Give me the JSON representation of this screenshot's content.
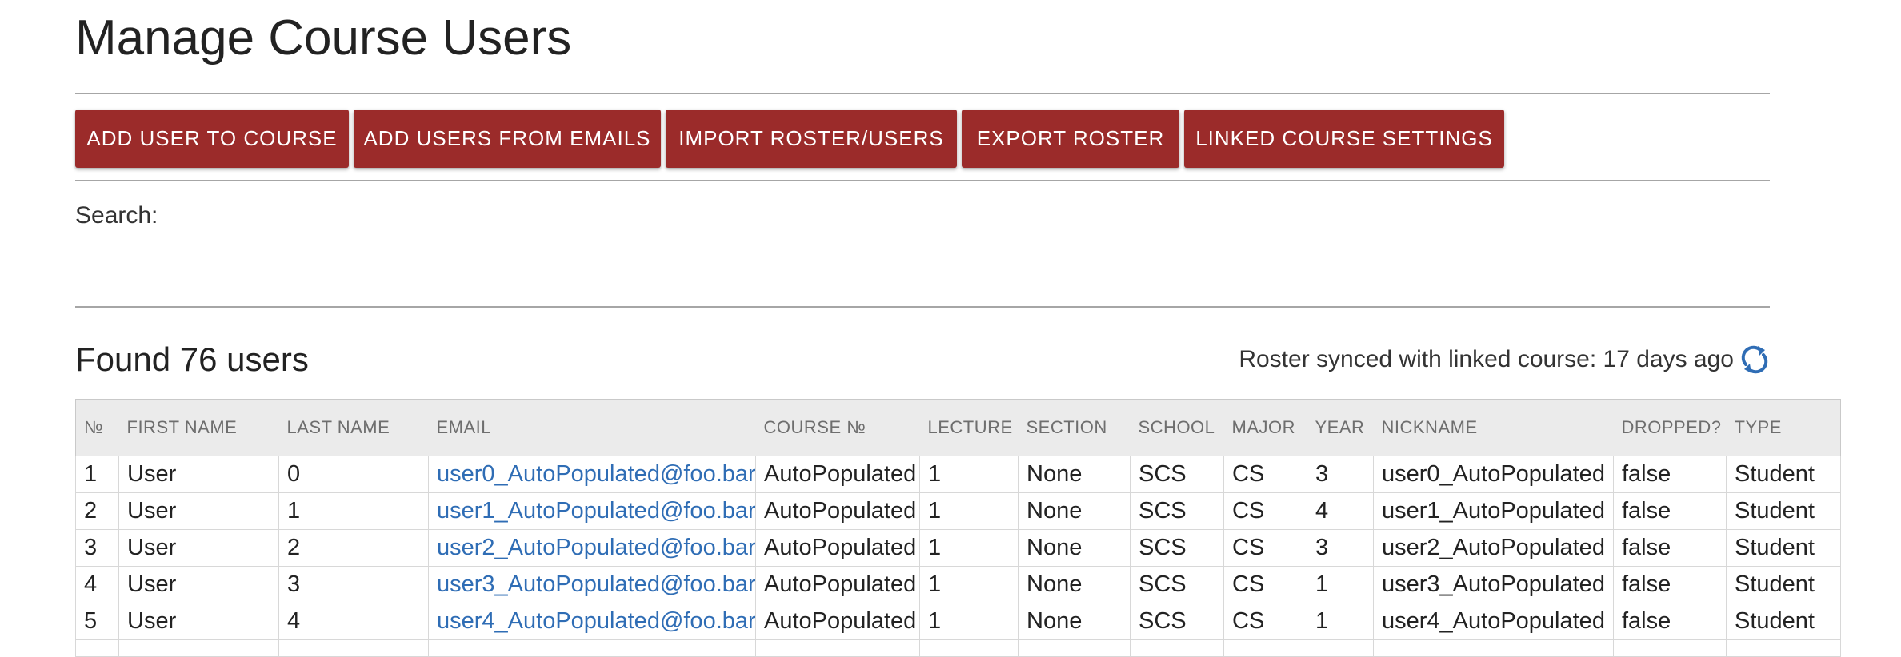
{
  "page_title": "Manage Course Users",
  "toolbar": {
    "buttons": [
      "ADD USER TO COURSE",
      "ADD USERS FROM EMAILS",
      "IMPORT ROSTER/USERS",
      "EXPORT ROSTER",
      "LINKED COURSE SETTINGS"
    ]
  },
  "search": {
    "label": "Search:",
    "value": ""
  },
  "results": {
    "heading": "Found 76 users",
    "sync_status": "Roster synced with linked course: 17 days ago",
    "sync_icon": "refresh-icon",
    "link_color": "#2f6db5"
  },
  "colors": {
    "button_bg": "#9b2b2a",
    "button_text": "#ffffff",
    "header_bg": "#ebebeb"
  },
  "table": {
    "columns": [
      "№",
      "FIRST NAME",
      "LAST NAME",
      "EMAIL",
      "COURSE №",
      "LECTURE",
      "SECTION",
      "SCHOOL",
      "MAJOR",
      "YEAR",
      "NICKNAME",
      "DROPPED?",
      "TYPE"
    ],
    "rows": [
      [
        "1",
        "User",
        "0",
        "user0_AutoPopulated@foo.bar",
        "AutoPopulated",
        "1",
        "None",
        "SCS",
        "CS",
        "3",
        "user0_AutoPopulated",
        "false",
        "Student"
      ],
      [
        "2",
        "User",
        "1",
        "user1_AutoPopulated@foo.bar",
        "AutoPopulated",
        "1",
        "None",
        "SCS",
        "CS",
        "4",
        "user1_AutoPopulated",
        "false",
        "Student"
      ],
      [
        "3",
        "User",
        "2",
        "user2_AutoPopulated@foo.bar",
        "AutoPopulated",
        "1",
        "None",
        "SCS",
        "CS",
        "3",
        "user2_AutoPopulated",
        "false",
        "Student"
      ],
      [
        "4",
        "User",
        "3",
        "user3_AutoPopulated@foo.bar",
        "AutoPopulated",
        "1",
        "None",
        "SCS",
        "CS",
        "1",
        "user3_AutoPopulated",
        "false",
        "Student"
      ],
      [
        "5",
        "User",
        "4",
        "user4_AutoPopulated@foo.bar",
        "AutoPopulated",
        "1",
        "None",
        "SCS",
        "CS",
        "1",
        "user4_AutoPopulated",
        "false",
        "Student"
      ]
    ]
  }
}
